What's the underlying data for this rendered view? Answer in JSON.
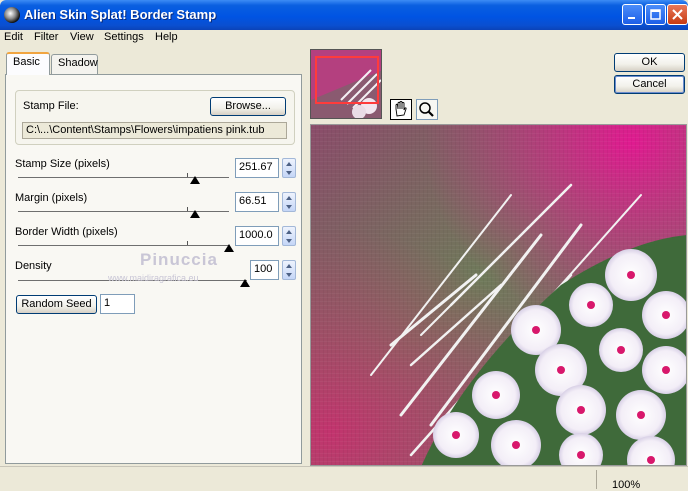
{
  "window": {
    "title": "Alien Skin Splat! Border Stamp"
  },
  "menu": [
    "Edit",
    "Filter",
    "View",
    "Settings",
    "Help"
  ],
  "tabs": [
    "Basic",
    "Shadow"
  ],
  "stamp": {
    "file_label": "Stamp File:",
    "browse_label": "Browse...",
    "path": "C:\\...\\Content\\Stamps\\Flowers\\impatiens pink.tub"
  },
  "params": [
    {
      "label": "Stamp Size (pixels)",
      "value": "251.67",
      "level": 0.7
    },
    {
      "label": "Margin (pixels)",
      "value": "66.51",
      "level": 0.7
    },
    {
      "label": "Border Width (pixels)",
      "value": "1000.0",
      "level": 1.0
    },
    {
      "label": "Density",
      "value": "100",
      "level": 1.0
    }
  ],
  "random_seed": {
    "button_label": "Random Seed",
    "value": "1"
  },
  "buttons": {
    "ok": "OK",
    "cancel": "Cancel"
  },
  "status": {
    "zoom": "100%"
  },
  "watermark": {
    "name": "Pinuccia",
    "url": "www.maidiragrafica.eu"
  },
  "icons": {
    "hand_tool": "hand-icon",
    "zoom_tool": "magnifier-icon"
  }
}
